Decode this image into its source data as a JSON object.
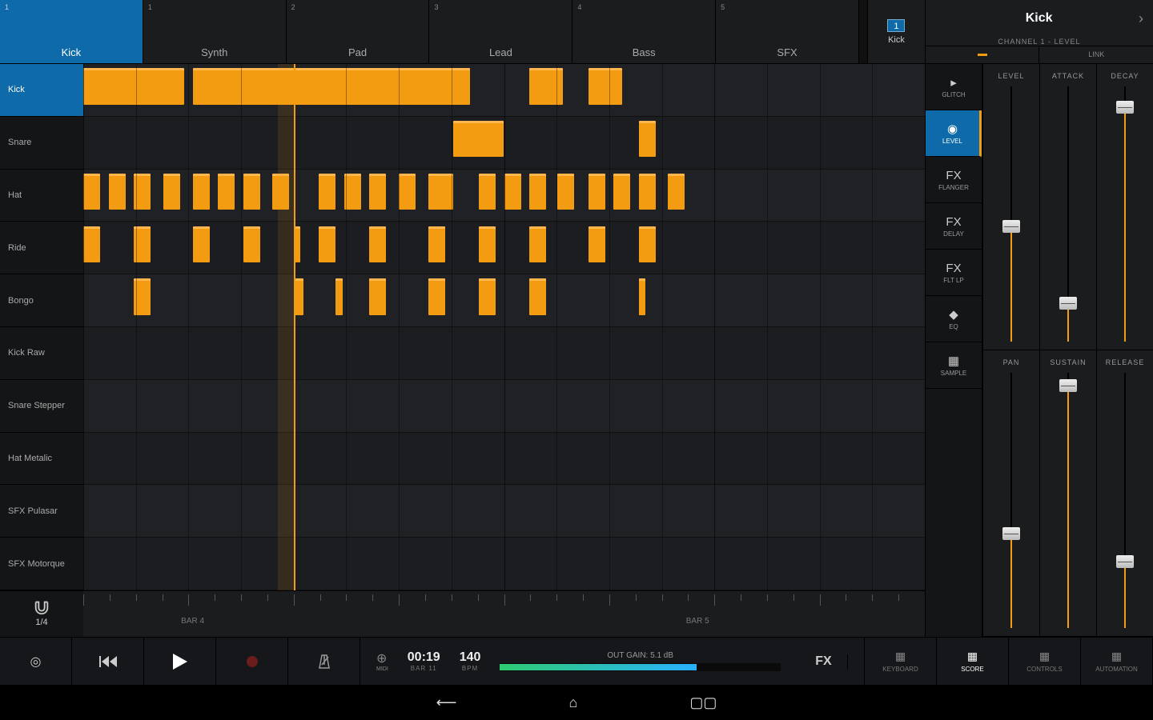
{
  "tracks": [
    {
      "label": "Kick",
      "num": "1",
      "active": true
    },
    {
      "label": "Synth",
      "num": "1"
    },
    {
      "label": "Pad",
      "num": "2"
    },
    {
      "label": "Lead",
      "num": "3"
    },
    {
      "label": "Bass",
      "num": "4"
    },
    {
      "label": "SFX",
      "num": "5"
    }
  ],
  "inspector": {
    "title": "Kick",
    "subtitle": "CHANNEL 1 - LEVEL",
    "link_label": "LINK"
  },
  "samples": [
    {
      "label": "Kick",
      "active": true
    },
    {
      "label": "Snare"
    },
    {
      "label": "Hat"
    },
    {
      "label": "Ride"
    },
    {
      "label": "Bongo"
    },
    {
      "label": "Kick Raw"
    },
    {
      "label": "Snare Stepper"
    },
    {
      "label": "Hat Metalic"
    },
    {
      "label": "SFX Pulasar"
    },
    {
      "label": "SFX Motorque"
    }
  ],
  "snap": "1/4",
  "ruler": {
    "bars": [
      "BAR 4",
      "BAR 5"
    ],
    "bar_positions": [
      13,
      73
    ]
  },
  "playhead_pct": 25,
  "grid_divisions": 16,
  "notes": {
    "0": [
      [
        0,
        12
      ],
      [
        13,
        14
      ],
      [
        25,
        14
      ],
      [
        36,
        10
      ],
      [
        53,
        4
      ],
      [
        60,
        4
      ]
    ],
    "1": [
      [
        44,
        6
      ],
      [
        66,
        2
      ]
    ],
    "2": [
      [
        0,
        2
      ],
      [
        3,
        2
      ],
      [
        6,
        2
      ],
      [
        9.5,
        2
      ],
      [
        13,
        2
      ],
      [
        16,
        2
      ],
      [
        19,
        2
      ],
      [
        22.5,
        2
      ],
      [
        28,
        2
      ],
      [
        31,
        2
      ],
      [
        34,
        2
      ],
      [
        37.5,
        2
      ],
      [
        41,
        3
      ],
      [
        47,
        2
      ],
      [
        50,
        2
      ],
      [
        53,
        2
      ],
      [
        56.3,
        2
      ],
      [
        60,
        2
      ],
      [
        63,
        2
      ],
      [
        66,
        2
      ],
      [
        69.5,
        2
      ]
    ],
    "3": [
      [
        0,
        2
      ],
      [
        6,
        2
      ],
      [
        13,
        2
      ],
      [
        19,
        2
      ],
      [
        25,
        0.8
      ],
      [
        28,
        2
      ],
      [
        34,
        2
      ],
      [
        41,
        2
      ],
      [
        47,
        2
      ],
      [
        53,
        2
      ],
      [
        60,
        2
      ],
      [
        66,
        2
      ]
    ],
    "4": [
      [
        6,
        2
      ],
      [
        25,
        1.2
      ],
      [
        30,
        0.8
      ],
      [
        34,
        2
      ],
      [
        41,
        2
      ],
      [
        47,
        2
      ],
      [
        53,
        2
      ],
      [
        66,
        0.8
      ]
    ]
  },
  "side_buttons": {
    "track_num": "1",
    "track_label": "Kick",
    "items": [
      {
        "label": "GLITCH",
        "icon": "▸"
      },
      {
        "label": "LEVEL",
        "icon": "◉",
        "active": true
      },
      {
        "label": "FLANGER",
        "icon": "FX"
      },
      {
        "label": "DELAY",
        "icon": "FX"
      },
      {
        "label": "FLT LP",
        "icon": "FX"
      },
      {
        "label": "EQ",
        "icon": "◆"
      },
      {
        "label": "SAMPLE",
        "icon": "▦"
      }
    ]
  },
  "params": [
    {
      "label": "LEVEL",
      "value": 45
    },
    {
      "label": "ATTACK",
      "value": 15
    },
    {
      "label": "DECAY",
      "value": 92
    },
    {
      "label": "PAN",
      "value": 37
    },
    {
      "label": "SUSTAIN",
      "value": 95
    },
    {
      "label": "RELEASE",
      "value": 26
    }
  ],
  "transport": {
    "time": "00:19",
    "time_sub": "BAR 11",
    "bpm": "140",
    "bpm_sub": "BPM",
    "gain": "OUT GAIN: 5.1 dB",
    "meter_pct": 70
  },
  "modes": [
    {
      "label": "KEYBOARD"
    },
    {
      "label": "SCORE",
      "active": true
    },
    {
      "label": "CONTROLS"
    },
    {
      "label": "AUTOMATION"
    }
  ]
}
